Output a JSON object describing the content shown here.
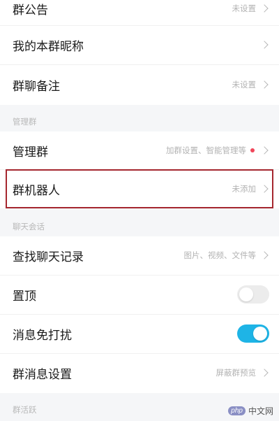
{
  "rows": {
    "announcement": {
      "label": "群公告",
      "value": "未设置"
    },
    "my_nickname": {
      "label": "我的本群昵称"
    },
    "group_remark": {
      "label": "群聊备注",
      "value": "未设置"
    },
    "manage_group": {
      "label": "管理群",
      "value": "加群设置、智能管理等"
    },
    "group_robot": {
      "label": "群机器人",
      "value": "未添加"
    },
    "find_chat": {
      "label": "查找聊天记录",
      "value": "图片、视频、文件等"
    },
    "pin_top": {
      "label": "置顶",
      "toggle_on": false
    },
    "do_not_disturb": {
      "label": "消息免打扰",
      "toggle_on": true
    },
    "msg_settings": {
      "label": "群消息设置",
      "value": "屏蔽群预览"
    }
  },
  "sections": {
    "manage": "管理群",
    "chat": "聊天会话",
    "active": "群活跃"
  },
  "watermark": {
    "logo": "php",
    "text": "中文网"
  },
  "colors": {
    "toggle_on": "#1eb4e6",
    "highlight_border": "#a5272f",
    "badge_dot": "#f0465a"
  },
  "icons": [
    "chevron-right-icon",
    "red-dot-icon",
    "toggle-switch"
  ]
}
